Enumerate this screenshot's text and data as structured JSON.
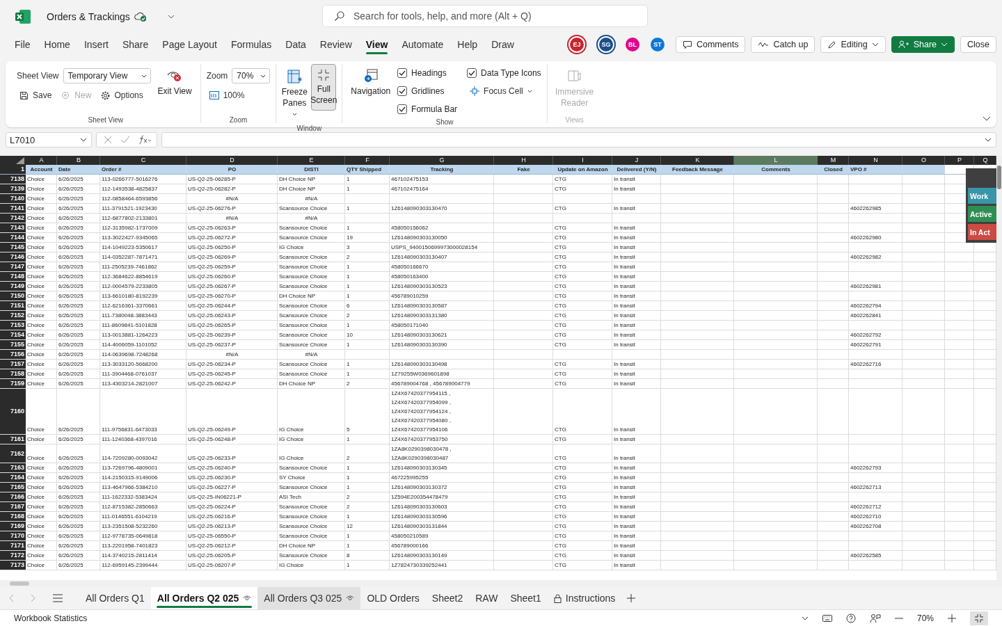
{
  "app": {
    "file_name": "Orders & Trackings",
    "search_placeholder": "Search for tools, help, and more (Alt + Q)"
  },
  "menu": [
    {
      "label": "File",
      "selected": false
    },
    {
      "label": "Home",
      "selected": false
    },
    {
      "label": "Insert",
      "selected": false
    },
    {
      "label": "Share",
      "selected": false
    },
    {
      "label": "Page Layout",
      "selected": false
    },
    {
      "label": "Formulas",
      "selected": false
    },
    {
      "label": "Data",
      "selected": false
    },
    {
      "label": "Review",
      "selected": false
    },
    {
      "label": "View",
      "selected": true
    },
    {
      "label": "Automate",
      "selected": false
    },
    {
      "label": "Help",
      "selected": false
    },
    {
      "label": "Draw",
      "selected": false
    }
  ],
  "collaborators": [
    {
      "initials": "EJ",
      "color": "#c4262e",
      "active": true
    },
    {
      "initials": "SG",
      "color": "#1b4f8a",
      "active": true
    },
    {
      "initials": "BL",
      "color": "#e3008c",
      "active": false
    },
    {
      "initials": "ST",
      "color": "#0f78d4",
      "active": false
    }
  ],
  "actions": [
    {
      "label": "Comments",
      "kind": "comments"
    },
    {
      "label": "Catch up",
      "kind": "catchup"
    },
    {
      "label": "Editing",
      "kind": "editing"
    },
    {
      "label": "Share",
      "kind": "share"
    },
    {
      "label": "Close",
      "kind": "close"
    }
  ],
  "ribbon": {
    "sheet_view": {
      "label": "Sheet View",
      "view_label": "Sheet View",
      "view_value": "Temporary View",
      "exit": "Exit View",
      "items": [
        {
          "label": "Save",
          "disabled": false
        },
        {
          "label": "New",
          "disabled": true
        },
        {
          "label": "Options",
          "disabled": false
        }
      ]
    },
    "zoom": {
      "label": "Zoom",
      "zoom_label": "Zoom",
      "zoom_value": "70%",
      "reset": "100%"
    },
    "window": {
      "label": "Window",
      "buttons": [
        {
          "label": "Freeze Panes",
          "selected": false,
          "kind": "freeze"
        },
        {
          "label": "Full Screen",
          "selected": true,
          "kind": "fullscreen"
        }
      ]
    },
    "show": {
      "label": "Show",
      "navigation": "Navigation",
      "checkboxes": [
        {
          "label": "Headings",
          "checked": true
        },
        {
          "label": "Gridlines",
          "checked": true
        },
        {
          "label": "Formula Bar",
          "checked": true
        },
        {
          "label": "Data Type Icons",
          "checked": true
        }
      ],
      "focus_cell": "Focus Cell"
    },
    "views": {
      "label": "Views",
      "button": "Immersive Reader",
      "disabled": true
    }
  },
  "formula_bar": {
    "name_box": "L7010"
  },
  "sheet": {
    "header_row_number": "1",
    "columns": [
      {
        "letter": "A",
        "header": "Account",
        "selected": false
      },
      {
        "letter": "B",
        "header": "Date",
        "selected": false
      },
      {
        "letter": "C",
        "header": "Order #",
        "selected": false
      },
      {
        "letter": "D",
        "header": "PO",
        "selected": false
      },
      {
        "letter": "E",
        "header": "DISTI",
        "selected": false
      },
      {
        "letter": "F",
        "header": "QTY Shipped",
        "selected": false
      },
      {
        "letter": "G",
        "header": "Tracking",
        "selected": false
      },
      {
        "letter": "H",
        "header": "Fake",
        "selected": false
      },
      {
        "letter": "I",
        "header": "Update on Amazon",
        "selected": false
      },
      {
        "letter": "J",
        "header": "Delivered (Y/N)",
        "selected": false
      },
      {
        "letter": "K",
        "header": "Feedback Message",
        "selected": false
      },
      {
        "letter": "L",
        "header": "Comments",
        "selected": true
      },
      {
        "letter": "M",
        "header": "Closed",
        "selected": false
      },
      {
        "letter": "N",
        "header": "VPO #",
        "selected": false
      },
      {
        "letter": "O",
        "selected": false
      },
      {
        "letter": "P",
        "selected": false
      },
      {
        "letter": "Q",
        "selected": false
      }
    ],
    "rows": [
      {
        "n": "7138",
        "cells": {
          "A": "Choice",
          "B": "6/26/2025",
          "C": "113-0266777-5016276",
          "D": "US-Q2-25-06285-P",
          "E": "DH Choice NP",
          "F": "1",
          "G": "467102475153",
          "I": "CTG",
          "J": "In transit"
        }
      },
      {
        "n": "7139",
        "cells": {
          "A": "Choice",
          "B": "6/26/2025",
          "C": "112-1493538-4825837",
          "D": "US-Q2-25-06282-P",
          "E": "DH Choice NP",
          "F": "1",
          "G": "467102475164",
          "I": "CTG",
          "J": "In transit"
        }
      },
      {
        "n": "7140",
        "cells": {
          "A": "Choice",
          "B": "6/26/2025",
          "C": "112-0858464-6593856",
          "D": {
            "text": "#N/A",
            "kind": "error"
          },
          "E": {
            "text": "#N/A",
            "kind": "error"
          }
        }
      },
      {
        "n": "7141",
        "cells": {
          "A": "Choice",
          "B": "6/26/2025",
          "C": "111-3791521-1923430",
          "D": "US-Q2-25-06276-P",
          "E": "Scansource Choice",
          "F": "1",
          "G": "1Z6148090303130470",
          "I": "CTG",
          "J": "In transit",
          "N": "4602262985"
        }
      },
      {
        "n": "7142",
        "cells": {
          "A": "Choice",
          "B": "6/26/2025",
          "C": "112-6877802-2133801",
          "D": {
            "text": "#N/A",
            "kind": "error"
          },
          "E": {
            "text": "#N/A",
            "kind": "error"
          }
        }
      },
      {
        "n": "7143",
        "cells": {
          "A": "Choice",
          "B": "6/26/2025",
          "C": "112-3135982-1737009",
          "D": "US-Q2-25-06263-P",
          "E": "Scansource Choice",
          "F": "1",
          "G": "458050156062",
          "I": "CTG",
          "J": "In transit"
        }
      },
      {
        "n": "7144",
        "cells": {
          "A": "Choice",
          "B": "6/26/2025",
          "C": "113-3022427-9345065",
          "D": "US-Q2-25-06272-P",
          "E": "Scansource Choice",
          "F": "19",
          "G": "1Z6148090303130050",
          "I": "CTG",
          "J": "In transit",
          "N": "4602262980"
        }
      },
      {
        "n": "7145",
        "cells": {
          "A": "Choice",
          "B": "6/26/2025",
          "C": "114-1049223-5350617",
          "D": "US-Q2-25-06250-P",
          "E": "IG Choice",
          "F": "3",
          "G": "USPS_9400150699973000028154",
          "I": "CTG",
          "J": "In transit"
        }
      },
      {
        "n": "7146",
        "cells": {
          "A": "Choice",
          "B": "6/26/2025",
          "C": "114-0352287-7871471",
          "D": "US-Q2-25-06269-P",
          "E": "Scansource Choice",
          "F": "2",
          "G": "1Z6148090303130407",
          "I": "CTG",
          "J": "In transit",
          "N": "4602262982"
        }
      },
      {
        "n": "7147",
        "cells": {
          "A": "Choice",
          "B": "6/26/2025",
          "C": "111-2505239-7461862",
          "D": "US-Q2-25-06259-P",
          "E": "Scansource Choice",
          "F": "1",
          "G": "458050166670",
          "I": "CTG",
          "J": "In transit"
        }
      },
      {
        "n": "7148",
        "cells": {
          "A": "Choice",
          "B": "6/26/2025",
          "C": "112-3684622-8854619",
          "D": "US-Q2-25-06260-P",
          "E": "Scansource Choice",
          "F": "1",
          "G": "458050163400",
          "I": "CTG",
          "J": "In transit"
        }
      },
      {
        "n": "7149",
        "cells": {
          "A": "Choice",
          "B": "6/26/2025",
          "C": "112-0004579-2233805",
          "D": "US-Q2-25-06267-P",
          "E": "Scansource Choice",
          "F": "1",
          "G": "1Z6148090303130523",
          "I": "CTG",
          "J": "In transit",
          "N": "4602262981"
        }
      },
      {
        "n": "7150",
        "cells": {
          "A": "Choice",
          "B": "6/26/2025",
          "C": "113-6610180-8192239",
          "D": "US-Q2-25-06270-P",
          "E": "DH Choice NP",
          "F": "1",
          "G": "456789010259",
          "I": "CTG",
          "J": "In transit"
        }
      },
      {
        "n": "7151",
        "cells": {
          "A": "Choice",
          "B": "6/26/2025",
          "C": "112-6216361-3370661",
          "D": "US-Q2-25-06244-P",
          "E": "Scansource Choice",
          "F": "6",
          "G": "1Z6148090303130587",
          "I": "CTG",
          "J": "In transit",
          "N": "4602262794"
        }
      },
      {
        "n": "7152",
        "cells": {
          "A": "Choice",
          "B": "6/26/2025",
          "C": "111-7380048-3883443",
          "D": "US-Q2-25-06243-P",
          "E": "Scansource Choice",
          "F": "2",
          "G": "1Z6148090303131380",
          "I": "CTG",
          "J": "In transit",
          "N": "4602262841"
        }
      },
      {
        "n": "7153",
        "cells": {
          "A": "Choice",
          "B": "6/26/2025",
          "C": "111-8609841-5101828",
          "D": "US-Q2-25-06265-P",
          "E": "Scansource Choice",
          "F": "1",
          "G": "458050171040",
          "I": "CTG",
          "J": "In transit"
        }
      },
      {
        "n": "7154",
        "cells": {
          "A": "Choice",
          "B": "6/26/2025",
          "C": "113-0013881-1264223",
          "D": "US-Q2-25-06239-P",
          "E": "Scansource Choice",
          "F": "10",
          "G": "1Z6148090303130621",
          "I": "CTG",
          "J": "In transit",
          "N": "4602262792"
        }
      },
      {
        "n": "7155",
        "cells": {
          "A": "Choice",
          "B": "6/26/2025",
          "C": "114-4006059-1101052",
          "D": "US-Q2-25-06237-P",
          "E": "Scansource Choice",
          "F": "1",
          "G": "1Z6148090303130390",
          "I": "CTG",
          "J": "In transit",
          "N": "4602262791"
        }
      },
      {
        "n": "7156",
        "cells": {
          "A": "Choice",
          "B": "6/26/2025",
          "C": "114-0639698-7248268",
          "D": {
            "text": "#N/A",
            "kind": "error"
          },
          "E": {
            "text": "#N/A",
            "kind": "error"
          }
        }
      },
      {
        "n": "7157",
        "cells": {
          "A": "Choice",
          "B": "6/26/2025",
          "C": "113-3033120-5668200",
          "D": "US-Q2-25-06234-P",
          "E": "Scansource Choice",
          "F": "1",
          "G": "1Z6148090303130498",
          "I": "CTG",
          "J": "In transit",
          "N": "4602262716"
        }
      },
      {
        "n": "7158",
        "cells": {
          "A": "Choice",
          "B": "6/26/2025",
          "C": "111-3904468-0761037",
          "D": "US-Q2-25-06245-P",
          "E": "Scansource Choice",
          "F": "1",
          "G": "1Z79255W0369601898",
          "I": "CTG",
          "J": "In transit"
        }
      },
      {
        "n": "7159",
        "cells": {
          "A": "Choice",
          "B": "6/26/2025",
          "C": "113-4303214-2821007",
          "D": "US-Q2-25-06242-P",
          "E": "DH Choice NP",
          "F": "2",
          "G": "456789004768 , 456789004779",
          "I": "CTG",
          "J": "In transit"
        }
      },
      {
        "n": "7160",
        "cells": {
          "A": "Choice",
          "B": "6/26/2025",
          "C": "111-9756831-6473033",
          "D": "US-Q2-25-06249-P",
          "E": "IG Choice",
          "F": "5",
          "G": "1Z4X67420377954115 ,\n1Z4X67420377954099 ,\n1Z4X67420377954124 ,\n1Z4X67420377954080 ,\n1Z4X67420377954106",
          "I": "CTG",
          "J": "In transit"
        }
      },
      {
        "n": "7161",
        "cells": {
          "A": "Choice",
          "B": "6/26/2025",
          "C": "111-1240368-4397016",
          "D": "US-Q2-25-06248-P",
          "E": "IG Choice",
          "F": "1",
          "G": "1Z4X67420377953750",
          "I": "CTG",
          "J": "In transit"
        }
      },
      {
        "n": "7162",
        "cells": {
          "A": "Choice",
          "B": "6/26/2025",
          "C": "114-7209280-0093042",
          "D": "US-Q2-25-06233-P",
          "E": "IG Choice",
          "F": "2",
          "G": "1ZA8K0290398030478 ,\n1ZA8K0290398030487",
          "I": "CTG",
          "J": "In transit"
        }
      },
      {
        "n": "7163",
        "cells": {
          "A": "Choice",
          "B": "6/26/2025",
          "C": "113-7269796-4809001",
          "D": "US-Q2-25-06240-P",
          "E": "Scansource Choice",
          "F": "1",
          "G": "1Z6148090303130345",
          "I": "CTG",
          "J": "In transit",
          "N": "4602262793"
        }
      },
      {
        "n": "7164",
        "cells": {
          "A": "Choice",
          "B": "6/26/2025",
          "C": "114-2150315-9149006",
          "D": "US-Q2-25-06230-P",
          "E": "SY Choice",
          "F": "1",
          "G": "467225995255",
          "I": "CTG",
          "J": "In transit"
        }
      },
      {
        "n": "7165",
        "cells": {
          "A": "Choice",
          "B": "6/26/2025",
          "C": "113-4647966-5384210",
          "D": "US-Q2-25-06227-P",
          "E": "Scansource Choice",
          "F": "1",
          "G": "1Z6148090303130372",
          "I": "CTG",
          "J": "In transit",
          "N": "4602262713"
        }
      },
      {
        "n": "7166",
        "cells": {
          "A": "Choice",
          "B": "6/26/2025",
          "C": "111-1622332-5383424",
          "D": "US-Q2-25-IN06221-P",
          "E": "ASI Tech",
          "F": "2",
          "G": "1Z594E200354478479",
          "I": "CTG",
          "J": "In transit"
        }
      },
      {
        "n": "7167",
        "cells": {
          "A": "Choice",
          "B": "6/26/2025",
          "C": "112-8715382-2850663",
          "D": "US-Q2-25-06224-P",
          "E": "Scansource Choice",
          "F": "2",
          "G": "1Z6148090303130603",
          "I": "CTG",
          "J": "In transit",
          "N": "4602262712"
        }
      },
      {
        "n": "7168",
        "cells": {
          "A": "Choice",
          "B": "6/26/2025",
          "C": "111-0146551-6104219",
          "D": "US-Q2-25-06216-P",
          "E": "Scansource Choice",
          "F": "1",
          "G": "1Z6148090303130596",
          "I": "CTG",
          "J": "In transit",
          "N": "4602262710"
        }
      },
      {
        "n": "7169",
        "cells": {
          "A": "Choice",
          "B": "6/26/2025",
          "C": "113-2351508-5232260",
          "D": "US-Q2-25-06213-P",
          "E": "Scansource Choice",
          "F": "12",
          "G": "1Z6148090303131844",
          "I": "CTG",
          "J": "In transit",
          "N": "4602262708"
        }
      },
      {
        "n": "7170",
        "cells": {
          "A": "Choice",
          "B": "6/26/2025",
          "C": "112-9778735-0649818",
          "D": "US-Q2-25-06550-P",
          "E": "Scansource Choice",
          "F": "1",
          "G": "458050210589",
          "I": "CTG",
          "J": "In transit"
        }
      },
      {
        "n": "7171",
        "cells": {
          "A": "Choice",
          "B": "6/26/2025",
          "C": "113-2201958-7401823",
          "D": "US-Q2-25-06212-P",
          "E": "DH Choice NP",
          "F": "1",
          "G": "456789000166",
          "I": "CTG",
          "J": "In transit"
        }
      },
      {
        "n": "7172",
        "cells": {
          "A": "Choice",
          "B": "6/26/2025",
          "C": "114-3740215-2811414",
          "D": "US-Q2-25-06205-P",
          "E": "Scansource Choice",
          "F": "8",
          "G": "1Z6148090303130149",
          "I": "CTG",
          "J": "In transit",
          "N": "4602262585"
        }
      },
      {
        "n": "7173",
        "cells": {
          "A": "Choice",
          "B": "6/26/2025",
          "C": "112-6959145-2399444",
          "D": "US-Q2-25-06207-P",
          "E": "IG Choice",
          "F": "1",
          "G": "1Z7824730339252441",
          "I": "CTG",
          "J": "In transit"
        }
      }
    ]
  },
  "filter_panel": {
    "buttons": [
      {
        "label": "Work",
        "color": "#3a95a8"
      },
      {
        "label": "Active",
        "color": "#2f8f52"
      },
      {
        "label": "In Act",
        "color": "#cc4b43"
      }
    ]
  },
  "sheet_tabs": [
    {
      "label": "All Orders Q1",
      "selected": false,
      "hovered": false,
      "kind": "plain"
    },
    {
      "label": "All Orders Q2 025",
      "selected": true,
      "hovered": false,
      "kind": "visible"
    },
    {
      "label": "All Orders Q3 025",
      "selected": false,
      "hovered": true,
      "kind": "visible"
    },
    {
      "label": "OLD Orders",
      "selected": false,
      "hovered": false,
      "kind": "plain"
    },
    {
      "label": "Sheet2",
      "selected": false,
      "hovered": false,
      "kind": "plain"
    },
    {
      "label": "RAW",
      "selected": false,
      "hovered": false,
      "kind": "plain"
    },
    {
      "label": "Sheet1",
      "selected": false,
      "hovered": false,
      "kind": "plain"
    },
    {
      "label": "Instructions",
      "selected": false,
      "hovered": false,
      "kind": "locked"
    }
  ],
  "status_bar": {
    "left": "Workbook Statistics",
    "zoom": "70%"
  }
}
